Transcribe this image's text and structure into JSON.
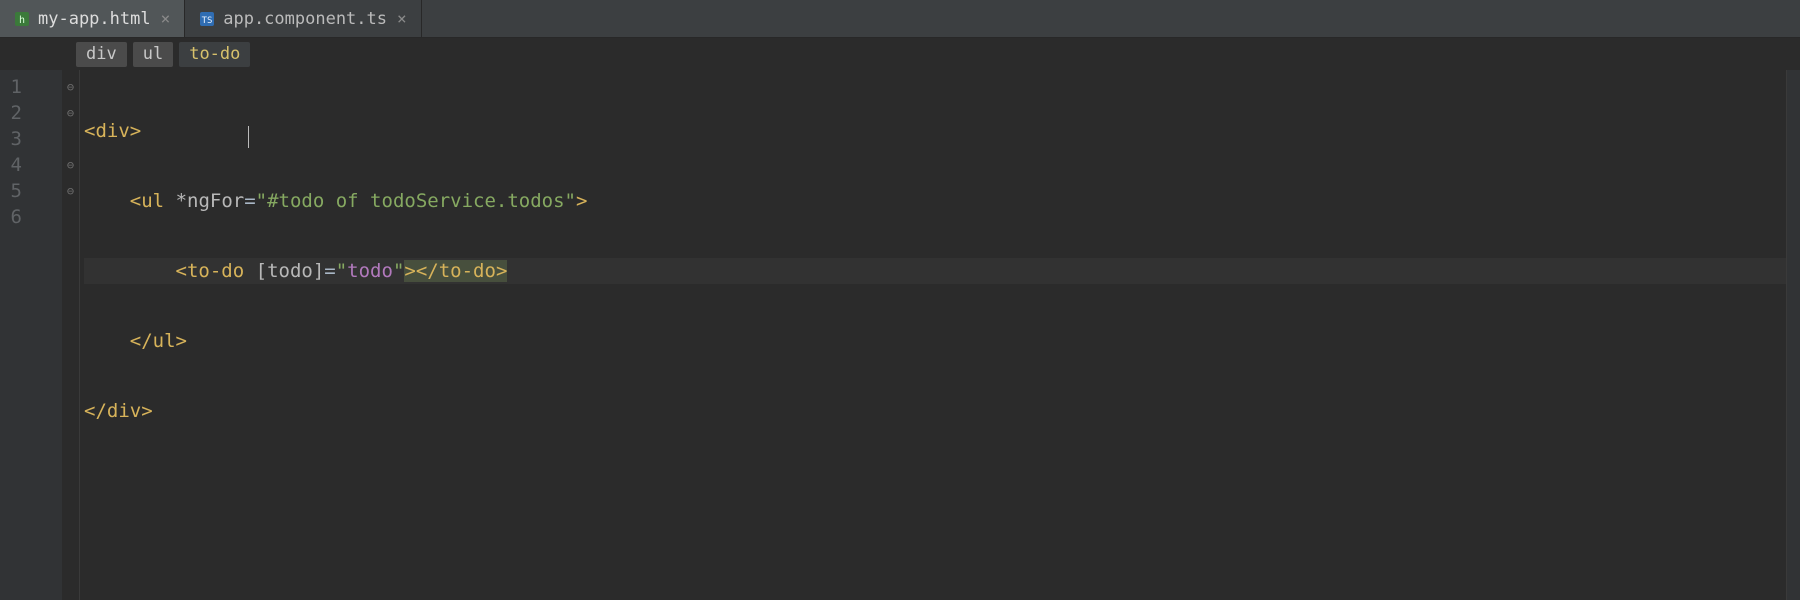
{
  "tabs": [
    {
      "label": "my-app.html",
      "active": true,
      "icon": "html-file-icon"
    },
    {
      "label": "app.component.ts",
      "active": false,
      "icon": "ts-file-icon"
    }
  ],
  "breadcrumbs": [
    {
      "label": "div",
      "active": false
    },
    {
      "label": "ul",
      "active": false
    },
    {
      "label": "to-do",
      "active": true
    }
  ],
  "lineNumbers": [
    "1",
    "2",
    "3",
    "4",
    "5",
    "6"
  ],
  "foldIcons": [
    "open",
    "open",
    "",
    "close",
    "close",
    ""
  ],
  "code": {
    "l1": {
      "op": "<",
      "tag": "div",
      "cl": ">"
    },
    "l2": {
      "indent": "    ",
      "op": "<",
      "tag": "ul",
      "sp": " ",
      "attr": "*ngFor",
      "eq": "=",
      "q1": "\"",
      "val": "#todo of todoService.todos",
      "q2": "\"",
      "cl": ">"
    },
    "l3": {
      "indent": "        ",
      "op": "<",
      "tag": "to-do",
      "sp": " ",
      "attr": "[todo]",
      "eq": "=",
      "q1": "\"",
      "val": "todo",
      "q2": "\"",
      "cl": ">",
      "op2": "</",
      "tag2": "to-do",
      "cl2": ">"
    },
    "l4": {
      "indent": "    ",
      "op": "</",
      "tag": "ul",
      "cl": ">"
    },
    "l5": {
      "op": "</",
      "tag": "div",
      "cl": ">"
    }
  },
  "caretLine": 3,
  "colors": {
    "bg": "#2b2b2b",
    "tag": "#d7b35a",
    "string": "#86a961",
    "keyword": "#b279bd"
  }
}
